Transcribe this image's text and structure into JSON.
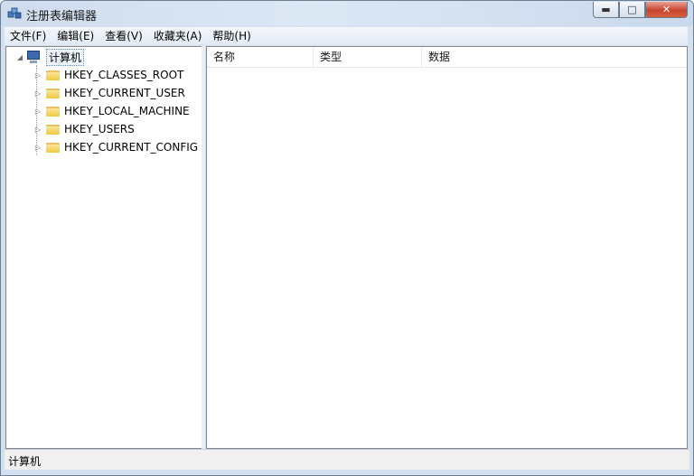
{
  "window": {
    "title": "注册表编辑器"
  },
  "menu": [
    {
      "label": "文件(F)"
    },
    {
      "label": "编辑(E)"
    },
    {
      "label": "查看(V)"
    },
    {
      "label": "收藏夹(A)"
    },
    {
      "label": "帮助(H)"
    }
  ],
  "tree": {
    "root": {
      "label": "计算机",
      "icon": "computer-icon"
    },
    "keys": [
      {
        "label": "HKEY_CLASSES_ROOT"
      },
      {
        "label": "HKEY_CURRENT_USER"
      },
      {
        "label": "HKEY_LOCAL_MACHINE"
      },
      {
        "label": "HKEY_USERS"
      },
      {
        "label": "HKEY_CURRENT_CONFIG"
      }
    ]
  },
  "list": {
    "columns": [
      {
        "label": "名称"
      },
      {
        "label": "类型"
      },
      {
        "label": "数据"
      }
    ]
  },
  "status": {
    "text": "计算机"
  },
  "colors": {
    "title_gradient": "#d6e3f3",
    "close_button": "#c7442f",
    "folder": "#f0c93d"
  }
}
